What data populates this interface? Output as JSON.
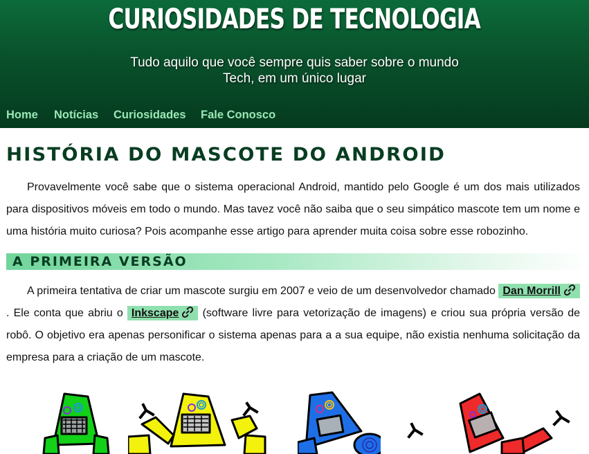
{
  "header": {
    "title": "CURIOSIDADES DE TECNOLOGIA",
    "subtitle_line1": "Tudo aquilo que você sempre quis saber sobre o mundo",
    "subtitle_line2": "Tech, em um único lugar"
  },
  "nav": {
    "items": [
      {
        "label": "Home"
      },
      {
        "label": "Notícias"
      },
      {
        "label": "Curiosidades"
      },
      {
        "label": "Fale Conosco"
      }
    ]
  },
  "article": {
    "title": "HISTÓRIA DO MASCOTE DO ANDROID",
    "intro": "Provavelmente você sabe que o sistema operacional Android, mantido pelo Google é um dos mais utilizados para dispositivos móveis em todo o mundo. Mas tavez você não saiba que o seu simpático mascote tem um nome e uma história muito curiosa? Pois acompanhe esse artigo para aprender muita coisa sobre esse robozinho.",
    "section1": {
      "title": "A PRIMEIRA VERSÃO",
      "text_part1": "A primeira tentativa de criar um mascote surgiu em 2007 e veio de um desenvolvedor chamado",
      "link1": "Dan Morrill",
      "text_part2": ". Ele conta que abriu o",
      "link2": "Inkscape",
      "text_part3": "(software livre para vetorização de imagens) e criou sua própria versão de robô. O objetivo era apenas personificar o sistema apenas para a a sua equipe, não existia nenhuma solicitação da empresa para a criação de um mascote."
    }
  },
  "robots": [
    {
      "color": "#12d118",
      "icon": "robot-illustration"
    },
    {
      "color": "#f2f20c",
      "icon": "robot-illustration"
    },
    {
      "color": "#1e6fe6",
      "icon": "robot-illustration"
    },
    {
      "color": "#ee2a2a",
      "icon": "robot-illustration"
    }
  ],
  "colors": {
    "header_green": "#0a5a30",
    "nav_link": "#9ae7b5",
    "title_green": "#083d21",
    "chip_bg": "#8fe0ae"
  }
}
